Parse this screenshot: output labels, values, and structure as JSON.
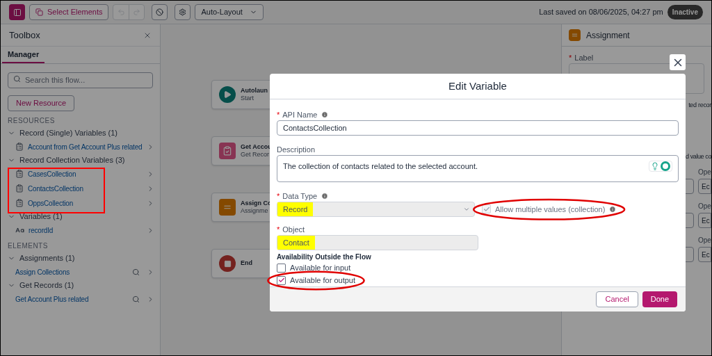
{
  "toolbar": {
    "select_elements": "Select Elements",
    "layout": "Auto-Layout",
    "last_saved": "Last saved on 08/06/2025, 04:27 pm",
    "status": "Inactive"
  },
  "toolbox": {
    "title": "Toolbox",
    "tabs": [
      {
        "label": "Manager",
        "selected": true
      }
    ],
    "search": {
      "placeholder": "Search this flow..."
    },
    "new_resource": "New Resource",
    "sections": [
      {
        "heading": "RESOURCES",
        "groups": [
          {
            "label": "Record (Single) Variables (1)",
            "expanded": true,
            "items": [
              {
                "label": "Account from Get Account Plus related",
                "kind": "record"
              }
            ]
          },
          {
            "label": "Record Collection Variables (3)",
            "expanded": true,
            "items": [
              {
                "label": "CasesCollection",
                "kind": "record"
              },
              {
                "label": "ContactsCollection",
                "kind": "record"
              },
              {
                "label": "OppsCollection",
                "kind": "record"
              }
            ]
          },
          {
            "label": "Variables (1)",
            "expanded": true,
            "items": [
              {
                "label": "recordId",
                "kind": "text"
              }
            ]
          }
        ]
      },
      {
        "heading": "ELEMENTS",
        "groups": [
          {
            "label": "Assignments (1)",
            "expanded": true,
            "items": [
              {
                "label": "Assign Collections",
                "kind": "element"
              }
            ]
          },
          {
            "label": "Get Records (1)",
            "expanded": true,
            "items": [
              {
                "label": "Get Account Plus related",
                "kind": "element"
              }
            ]
          }
        ]
      }
    ]
  },
  "canvas": {
    "nodes": [
      {
        "kind": "start",
        "title": "Autolaun",
        "subtitle": "Start"
      },
      {
        "kind": "get_records",
        "title": "Get Accou",
        "subtitle": "Get Recor"
      },
      {
        "kind": "assignment",
        "title": "Assign Co",
        "subtitle": "Assignme"
      },
      {
        "kind": "end",
        "title": "End"
      }
    ]
  },
  "properties_panel": {
    "title": "Assignment",
    "label_field": {
      "required_mark": "*",
      "label": "Label"
    },
    "fragments": [
      "ted recor",
      "d value co"
    ],
    "rows": [
      {
        "label": "Ope",
        "value": "Ec"
      },
      {
        "label": "Ope",
        "value": "Ec"
      },
      {
        "label": "Ope",
        "value": "Ec"
      }
    ]
  },
  "dialog": {
    "title": "Edit Variable",
    "api_name": {
      "required_mark": "*",
      "label": "API Name",
      "value": "ContactsCollection"
    },
    "description": {
      "label": "Description",
      "value": "The collection of contacts related to the selected account."
    },
    "data_type": {
      "required_mark": "*",
      "label": "Data Type",
      "value": "Record",
      "highlighted": true
    },
    "allow_multiple": {
      "label": "Allow multiple values (collection)",
      "checked": true,
      "disabled": true
    },
    "object": {
      "required_mark": "*",
      "label": "Object",
      "value": "Contact",
      "highlighted": true
    },
    "availability": {
      "heading": "Availability Outside the Flow",
      "options": [
        {
          "label": "Available for input",
          "checked": false
        },
        {
          "label": "Available for output",
          "checked": true
        }
      ]
    },
    "buttons": [
      {
        "label": "Cancel",
        "kind": "secondary"
      },
      {
        "label": "Done",
        "kind": "primary"
      }
    ]
  }
}
